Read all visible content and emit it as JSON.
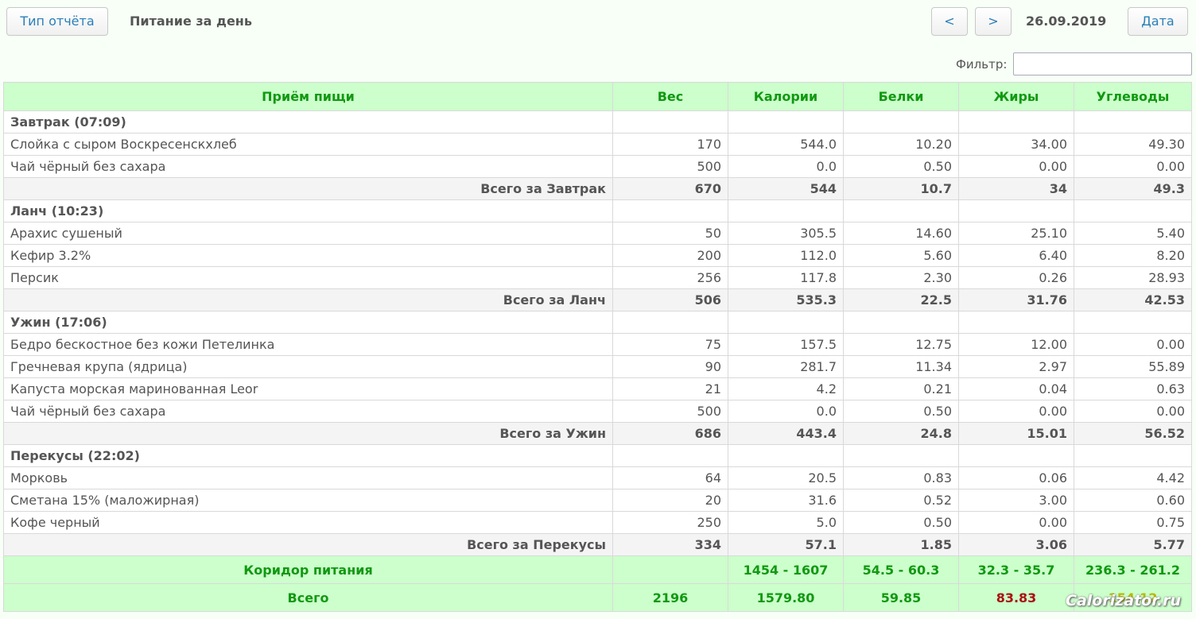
{
  "header": {
    "report_type_label": "Тип отчёта",
    "title": "Питание за день",
    "prev_label": "<",
    "next_label": ">",
    "date": "26.09.2019",
    "date_label": "Дата"
  },
  "filter": {
    "label": "Фильтр:",
    "value": ""
  },
  "table": {
    "columns": [
      "Приём пищи",
      "Вес",
      "Калории",
      "Белки",
      "Жиры",
      "Углеводы"
    ],
    "meals": [
      {
        "name": "Завтрак (07:09)",
        "items": [
          {
            "name": "Слойка с сыром Воскресенскхлеб",
            "weight": "170",
            "kcal": "544.0",
            "protein": "10.20",
            "fat": "34.00",
            "carbs": "49.30"
          },
          {
            "name": "Чай чёрный без сахара",
            "weight": "500",
            "kcal": "0.0",
            "protein": "0.50",
            "fat": "0.00",
            "carbs": "0.00"
          }
        ],
        "total": {
          "label": "Всего за Завтрак",
          "weight": "670",
          "kcal": "544",
          "protein": "10.7",
          "fat": "34",
          "carbs": "49.3"
        }
      },
      {
        "name": "Ланч (10:23)",
        "items": [
          {
            "name": "Арахис сушеный",
            "weight": "50",
            "kcal": "305.5",
            "protein": "14.60",
            "fat": "25.10",
            "carbs": "5.40"
          },
          {
            "name": "Кефир 3.2%",
            "weight": "200",
            "kcal": "112.0",
            "protein": "5.60",
            "fat": "6.40",
            "carbs": "8.20"
          },
          {
            "name": "Персик",
            "weight": "256",
            "kcal": "117.8",
            "protein": "2.30",
            "fat": "0.26",
            "carbs": "28.93"
          }
        ],
        "total": {
          "label": "Всего за Ланч",
          "weight": "506",
          "kcal": "535.3",
          "protein": "22.5",
          "fat": "31.76",
          "carbs": "42.53"
        }
      },
      {
        "name": "Ужин (17:06)",
        "items": [
          {
            "name": "Бедро бескостное без кожи Петелинка",
            "weight": "75",
            "kcal": "157.5",
            "protein": "12.75",
            "fat": "12.00",
            "carbs": "0.00"
          },
          {
            "name": "Гречневая крупа (ядрица)",
            "weight": "90",
            "kcal": "281.7",
            "protein": "11.34",
            "fat": "2.97",
            "carbs": "55.89"
          },
          {
            "name": "Капуста морская маринованная Leor",
            "weight": "21",
            "kcal": "4.2",
            "protein": "0.21",
            "fat": "0.04",
            "carbs": "0.63"
          },
          {
            "name": "Чай чёрный без сахара",
            "weight": "500",
            "kcal": "0.0",
            "protein": "0.50",
            "fat": "0.00",
            "carbs": "0.00"
          }
        ],
        "total": {
          "label": "Всего за Ужин",
          "weight": "686",
          "kcal": "443.4",
          "protein": "24.8",
          "fat": "15.01",
          "carbs": "56.52"
        }
      },
      {
        "name": "Перекусы (22:02)",
        "items": [
          {
            "name": "Морковь",
            "weight": "64",
            "kcal": "20.5",
            "protein": "0.83",
            "fat": "0.06",
            "carbs": "4.42"
          },
          {
            "name": "Сметана 15% (маложирная)",
            "weight": "20",
            "kcal": "31.6",
            "protein": "0.52",
            "fat": "3.00",
            "carbs": "0.60"
          },
          {
            "name": "Кофе черный",
            "weight": "250",
            "kcal": "5.0",
            "protein": "0.50",
            "fat": "0.00",
            "carbs": "0.75"
          }
        ],
        "total": {
          "label": "Всего за Перекусы",
          "weight": "334",
          "kcal": "57.1",
          "protein": "1.85",
          "fat": "3.06",
          "carbs": "5.77"
        }
      }
    ],
    "corridor": {
      "label": "Коридор питания",
      "weight": "",
      "kcal": "1454 - 1607",
      "protein": "54.5 - 60.3",
      "fat": "32.3 - 35.7",
      "carbs": "236.3 - 261.2"
    },
    "grand_total": {
      "label": "Всего",
      "weight": "2196",
      "kcal": "1579.80",
      "protein": "59.85",
      "fat": "83.83",
      "carbs": "154.12"
    }
  },
  "colors": {
    "header_bg": "#ccffcc",
    "header_text": "#119911",
    "over_limit": "#aa1111",
    "under_limit": "#b9b900",
    "link": "#2a7fb8"
  },
  "watermark": "Calorizator.ru"
}
